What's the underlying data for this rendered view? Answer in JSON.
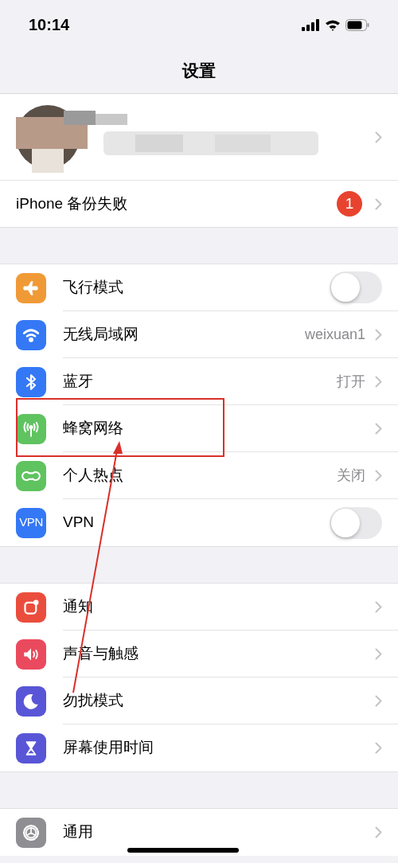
{
  "status_bar": {
    "time": "10:14"
  },
  "title": "设置",
  "backup_row": {
    "label": "iPhone 备份失败",
    "badge": "1"
  },
  "groups": [
    [
      {
        "kind": "toggle",
        "label": "飞行模式",
        "on": false
      },
      {
        "kind": "value",
        "label": "无线局域网",
        "value": "weixuan1"
      },
      {
        "kind": "value",
        "label": "蓝牙",
        "value": "打开"
      },
      {
        "kind": "link",
        "label": "蜂窝网络"
      },
      {
        "kind": "value",
        "label": "个人热点",
        "value": "关闭"
      },
      {
        "kind": "toggle",
        "label": "VPN",
        "on": false,
        "icon_text": "VPN"
      }
    ],
    [
      {
        "kind": "link",
        "label": "通知"
      },
      {
        "kind": "link",
        "label": "声音与触感"
      },
      {
        "kind": "link",
        "label": "勿扰模式"
      },
      {
        "kind": "link",
        "label": "屏幕使用时间"
      }
    ],
    [
      {
        "kind": "link",
        "label": "通用"
      }
    ]
  ]
}
